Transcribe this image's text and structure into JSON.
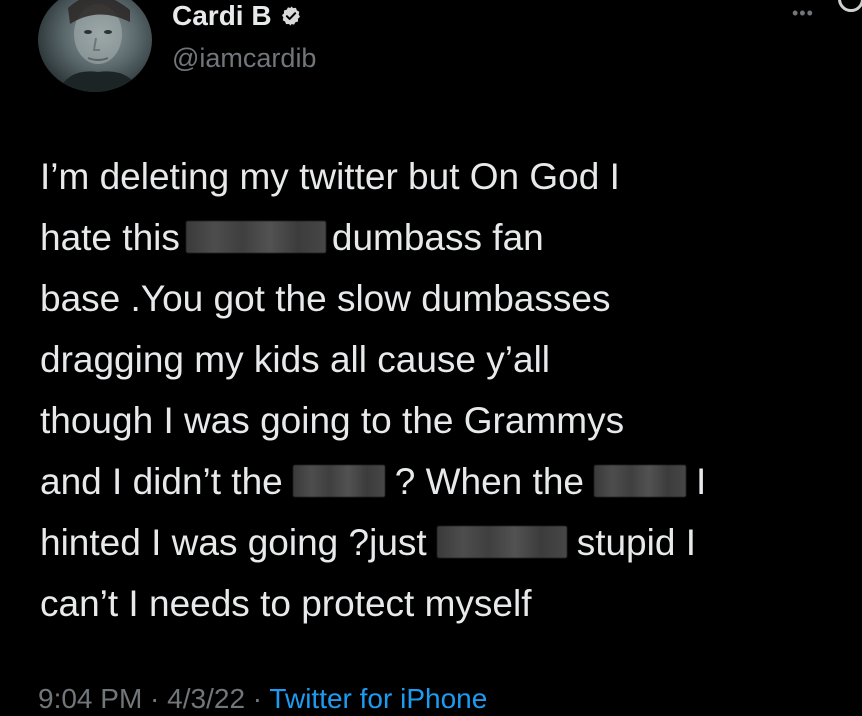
{
  "tweet": {
    "author": {
      "display_name": "Cardi B",
      "handle": "@iamcardib",
      "verified_icon": "verified-badge-icon"
    },
    "more_icon": "•••",
    "body_lines": {
      "l1": "I’m deleting my twitter but On God I",
      "l2a": "hate this",
      "l2b": "dumbass fan",
      "l3": "base .You got the slow dumbasses",
      "l4": "dragging my kids all cause y’all",
      "l5": "though I was going to the Grammys",
      "l6a": "and I didn’t the",
      "l6b": "? When the",
      "l6c": "I",
      "l7a": "hinted I was going ?just",
      "l7b": "stupid I",
      "l8": "can’t I needs to protect myself"
    },
    "meta": {
      "time": "9:04 PM",
      "separator": " · ",
      "date": "4/3/22",
      "source": "Twitter for iPhone"
    }
  },
  "colors": {
    "background": "#000000",
    "text": "#e7e9ea",
    "secondary_text": "#71767b",
    "link": "#1d9bf0",
    "verified_badge": "#d9d9d9"
  }
}
